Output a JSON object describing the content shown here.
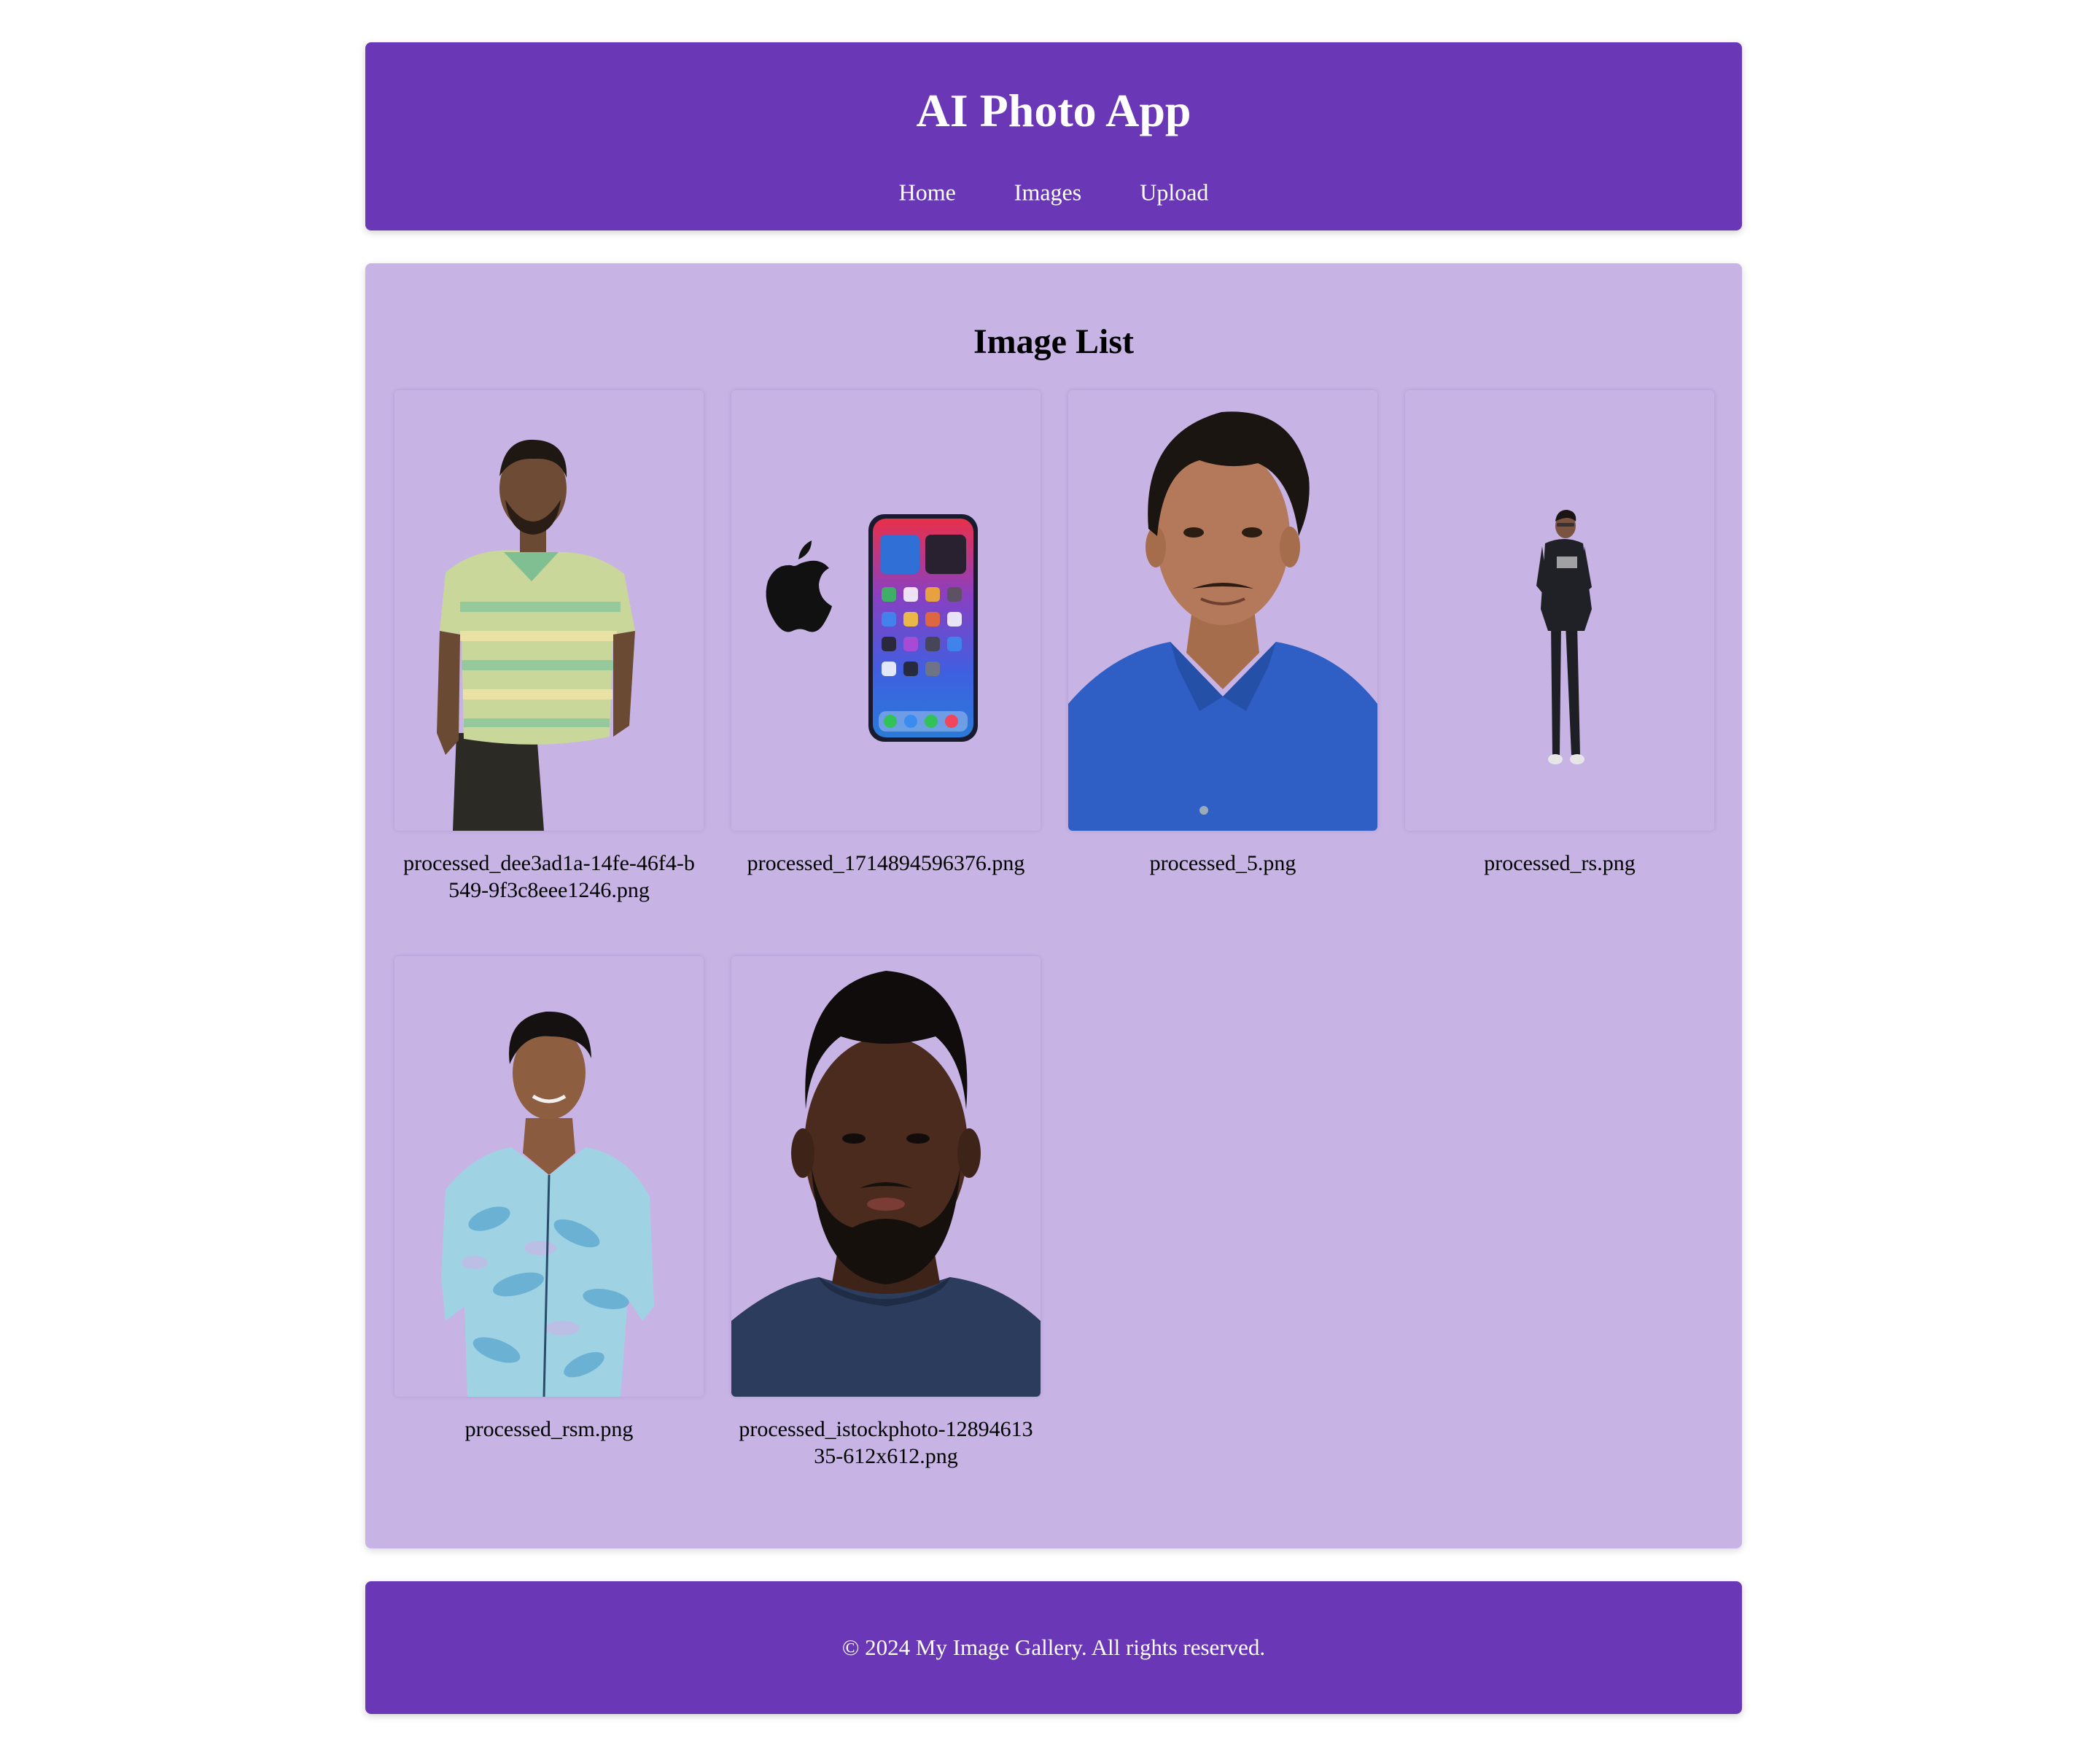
{
  "header": {
    "title": "AI Photo App",
    "nav": [
      "Home",
      "Images",
      "Upload"
    ]
  },
  "main": {
    "title": "Image List",
    "images": [
      {
        "filename": "processed_dee3ad1a-14fe-46f4-b549-9f3c8eee1246.png",
        "subject": "man-striped-polo"
      },
      {
        "filename": "processed_1714894596376.png",
        "subject": "iphone-with-apple-logo"
      },
      {
        "filename": "processed_5.png",
        "subject": "man-blue-shirt-portrait"
      },
      {
        "filename": "processed_rs.png",
        "subject": "man-black-outfit-small"
      },
      {
        "filename": "processed_rsm.png",
        "subject": "man-floral-shirt"
      },
      {
        "filename": "processed_istockphoto-1289461335-612x612.png",
        "subject": "bearded-man-portrait"
      }
    ]
  },
  "footer": {
    "text": "© 2024 My Image Gallery. All rights reserved."
  },
  "colors": {
    "header_bg": "#6a38b7",
    "main_bg": "#c7b4e5",
    "text_on_accent": "#ffffff"
  }
}
